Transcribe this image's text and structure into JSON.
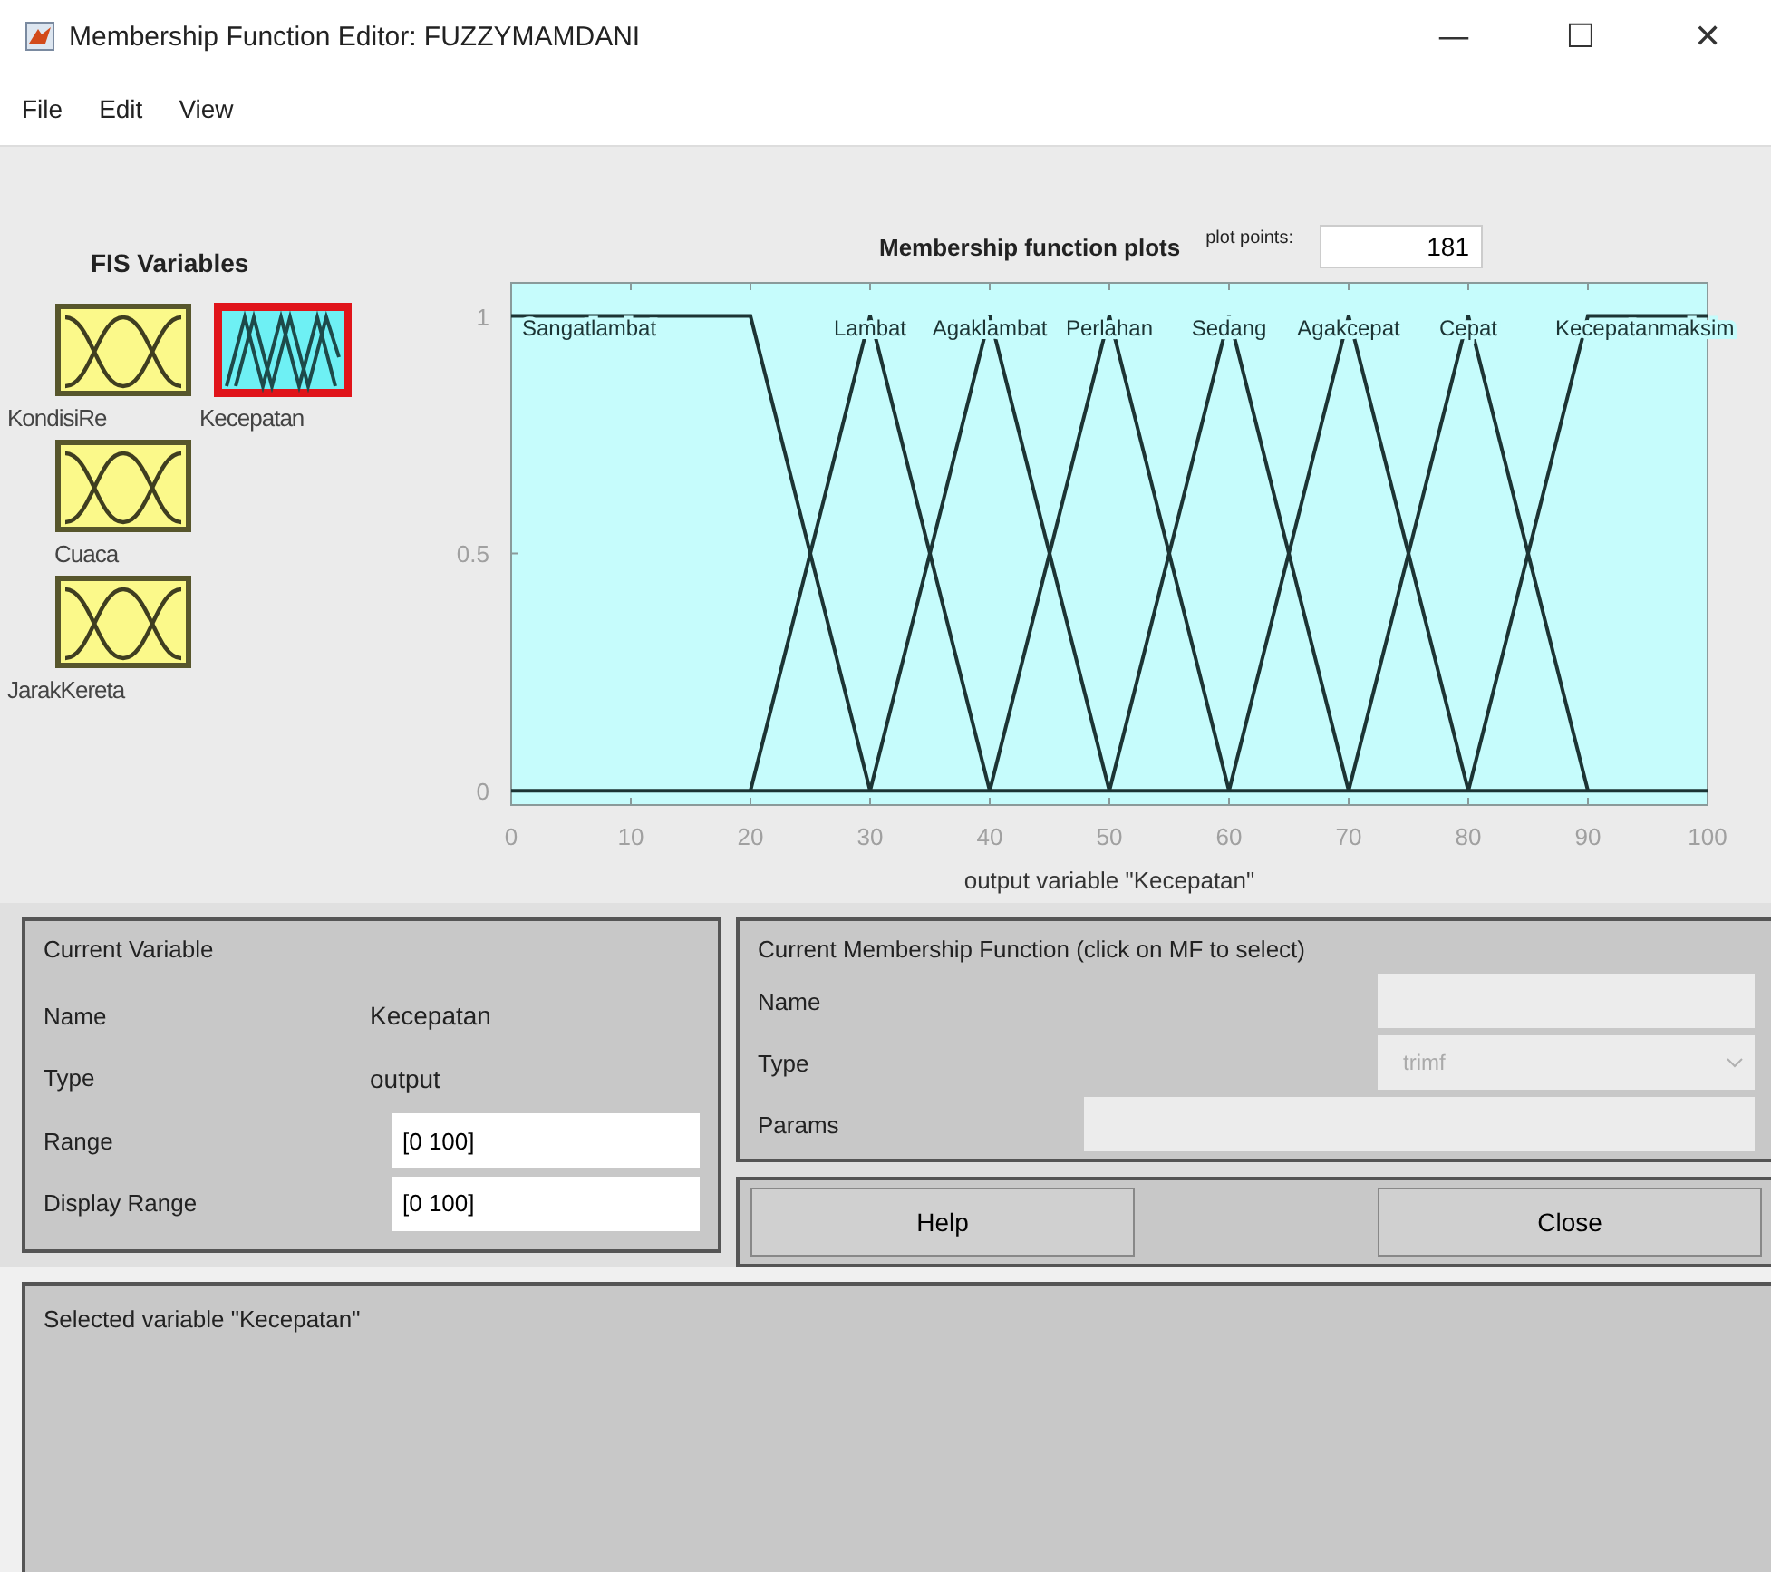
{
  "window": {
    "title": "Membership Function Editor: FUZZYMAMDANI",
    "controls": [
      "—",
      "☐",
      "✕"
    ]
  },
  "menu": [
    "File",
    "Edit",
    "View"
  ],
  "fis_variables": {
    "title": "FIS Variables",
    "items": [
      {
        "label": "KondisiRe",
        "kind": "input",
        "selected": false
      },
      {
        "label": "Kecepatan",
        "kind": "output",
        "selected": true
      },
      {
        "label": "Cuaca",
        "kind": "input",
        "selected": false
      },
      {
        "label": "JarakKereta",
        "kind": "input",
        "selected": false
      }
    ]
  },
  "plot": {
    "plot_points_label": "plot points:",
    "plot_points": "181",
    "chart_data": {
      "type": "line",
      "title": "Membership function plots",
      "xlabel": "output variable \"Kecepatan\"",
      "x": [
        0,
        5,
        10,
        15,
        20,
        25,
        30,
        35,
        40,
        45,
        50,
        55,
        60,
        65,
        70,
        75,
        80,
        85,
        90,
        95,
        100
      ],
      "xlim": [
        0,
        100
      ],
      "ylim": [
        -0.03,
        1.07
      ],
      "xticks": [
        0,
        10,
        20,
        30,
        40,
        50,
        60,
        70,
        80,
        90,
        100
      ],
      "yticks": [
        0,
        0.5,
        1
      ],
      "series": [
        {
          "name": "Sangatlambat",
          "color": "#1c3434",
          "values": [
            1,
            1,
            1,
            1,
            1,
            0.5,
            0,
            null,
            null,
            null,
            null,
            null,
            null,
            null,
            null,
            null,
            null,
            null,
            null,
            null,
            null
          ]
        },
        {
          "name": "Lambat",
          "color": "#1c3434",
          "values": [
            null,
            null,
            null,
            null,
            0,
            0.5,
            1,
            0.5,
            0,
            null,
            null,
            null,
            null,
            null,
            null,
            null,
            null,
            null,
            null,
            null,
            null
          ]
        },
        {
          "name": "Agaklambat",
          "color": "#1c3434",
          "values": [
            null,
            null,
            null,
            null,
            null,
            null,
            0,
            0.5,
            1,
            0.5,
            0,
            null,
            null,
            null,
            null,
            null,
            null,
            null,
            null,
            null,
            null
          ]
        },
        {
          "name": "Perlahan",
          "color": "#1c3434",
          "values": [
            null,
            null,
            null,
            null,
            null,
            null,
            null,
            null,
            0,
            0.5,
            1,
            0.5,
            0,
            null,
            null,
            null,
            null,
            null,
            null,
            null,
            null
          ]
        },
        {
          "name": "Sedang",
          "color": "#1c3434",
          "values": [
            null,
            null,
            null,
            null,
            null,
            null,
            null,
            null,
            null,
            null,
            0,
            0.5,
            1,
            0.5,
            0,
            null,
            null,
            null,
            null,
            null,
            null
          ]
        },
        {
          "name": "Agakcepat",
          "color": "#1c3434",
          "values": [
            null,
            null,
            null,
            null,
            null,
            null,
            null,
            null,
            null,
            null,
            null,
            null,
            0,
            0.5,
            1,
            0.5,
            0,
            null,
            null,
            null,
            null
          ]
        },
        {
          "name": "Cepat",
          "color": "#1c3434",
          "values": [
            null,
            null,
            null,
            null,
            null,
            null,
            null,
            null,
            null,
            null,
            null,
            null,
            null,
            null,
            0,
            0.5,
            1,
            0.5,
            0,
            null,
            null
          ]
        },
        {
          "name": "Kecepatanmaksim",
          "color": "#1c3434",
          "values": [
            null,
            null,
            null,
            null,
            null,
            null,
            null,
            null,
            null,
            null,
            null,
            null,
            null,
            null,
            null,
            null,
            0,
            0.5,
            1,
            1,
            1
          ]
        }
      ]
    }
  },
  "current_variable": {
    "title": "Current Variable",
    "rows": [
      {
        "label": "Name",
        "value": "Kecepatan",
        "kind": "text"
      },
      {
        "label": "Type",
        "value": "output",
        "kind": "text"
      },
      {
        "label": "Range",
        "value": "[0 100]",
        "kind": "field"
      },
      {
        "label": "Display Range",
        "value": "[0 100]",
        "kind": "field"
      }
    ]
  },
  "current_mf": {
    "title": "Current Membership Function (click on MF to select)",
    "name_label": "Name",
    "type_label": "Type",
    "type_value": "trimf",
    "params_label": "Params"
  },
  "buttons": [
    "Help",
    "Close"
  ],
  "status": "Selected variable \"Kecepatan\""
}
